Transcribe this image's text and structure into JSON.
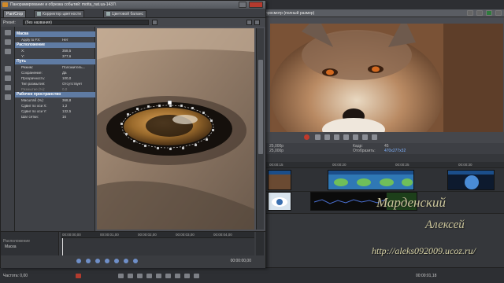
{
  "dialog": {
    "title": "Панорамирование и обрезка событий: motta_nat.ua-1437\\",
    "tabs": [
      {
        "label": "Pan/Crop"
      },
      {
        "label": "Корректор цветности"
      },
      {
        "label": "Цветовой баланс"
      }
    ],
    "preset_label": "Preset:",
    "preset_value": "(без названия)",
    "props": {
      "mask_header": "Маска",
      "apply_fx_key": "Apply to FX:",
      "apply_fx_val": "Нет",
      "position_header": "Расположение",
      "x_key": "X:",
      "x_val": "358,5",
      "y_key": "Y:",
      "y_val": "377,6",
      "path_header": "Путь",
      "mode_key": "Режим:",
      "mode_val": "Положитель...",
      "enabled_key": "Сохранение:",
      "enabled_val": "Да",
      "opacity_key": "Прозрачность:",
      "opacity_val": "100,0",
      "blur_key": "Тип размытия:",
      "blur_val": "Отсутствует",
      "blur_pct_key": "Размытие (%):",
      "blur_pct_val": "0,0",
      "work_header": "Рабочее пространство",
      "zoom_key": "Масштаб (%):",
      "zoom_val": "368,8",
      "xoff_key": "Сдвиг по оси X:",
      "xoff_val": "1,2",
      "yoff_key": "Сдвиг по оси Y:",
      "yoff_val": "132,5",
      "grid_key": "Шаг сетки:",
      "grid_val": "16"
    },
    "keyframes": {
      "list_header": "Расположение",
      "list_item": "Маска",
      "ruler": [
        "00:00:00,00",
        "00:00:01,00",
        "00:00:02,00",
        "00:00:03,00",
        "00:00:04,00"
      ],
      "time": "00:00:00,00"
    }
  },
  "preview": {
    "title": "просмотр (полный размер)",
    "info_left": "25,000p",
    "info_left2": "25,000p",
    "frame_label": "Кадр:",
    "frame_value": "45",
    "display_label": "Отобразить:",
    "display_value": "470x277x32"
  },
  "timeline": {
    "ruler": [
      "00:00:15",
      "00:00:20",
      "00:00:25",
      "00:00:30"
    ]
  },
  "status": {
    "rate": "Частота: 0,00",
    "time": "00:00:01,18"
  },
  "watermark": {
    "line1": "Марденский",
    "line2": "Алексей",
    "line3": "http://aleks092009.ucoz.ru/"
  },
  "colors": {
    "accent": "#5f7ba3",
    "record": "#c0392b"
  }
}
